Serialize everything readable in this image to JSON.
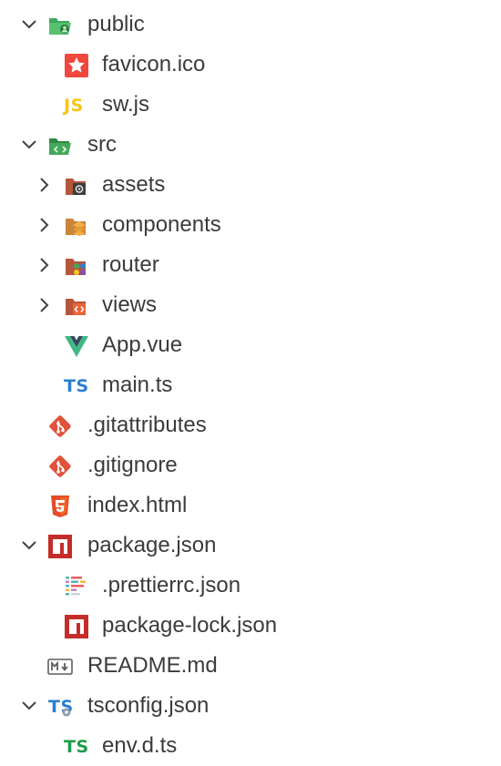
{
  "explorer": {
    "items": [
      {
        "label": "public",
        "icon": "folder-public-open-icon",
        "expanded": true
      },
      {
        "label": "favicon.ico",
        "icon": "favicon-icon"
      },
      {
        "label": "sw.js",
        "icon": "javascript-file-icon",
        "icon_text": "JS",
        "icon_color": "#f5c518"
      },
      {
        "label": "src",
        "icon": "folder-src-open-icon",
        "expanded": true
      },
      {
        "label": "assets",
        "icon": "folder-assets-icon",
        "expanded": false
      },
      {
        "label": "components",
        "icon": "folder-components-icon",
        "expanded": false
      },
      {
        "label": "router",
        "icon": "folder-router-icon",
        "expanded": false
      },
      {
        "label": "views",
        "icon": "folder-views-icon",
        "expanded": false
      },
      {
        "label": "App.vue",
        "icon": "vue-file-icon"
      },
      {
        "label": "main.ts",
        "icon": "typescript-file-icon",
        "icon_text": "TS",
        "icon_color": "#2b7fd0"
      },
      {
        "label": ".gitattributes",
        "icon": "git-icon"
      },
      {
        "label": ".gitignore",
        "icon": "git-icon"
      },
      {
        "label": "index.html",
        "icon": "html5-icon"
      },
      {
        "label": "package.json",
        "icon": "npm-icon",
        "expanded": true
      },
      {
        "label": ".prettierrc.json",
        "icon": "prettier-icon"
      },
      {
        "label": "package-lock.json",
        "icon": "npm-icon"
      },
      {
        "label": "README.md",
        "icon": "markdown-icon"
      },
      {
        "label": "tsconfig.json",
        "icon": "tsconfig-icon",
        "icon_text": "TS",
        "icon_color": "#2b7fd0",
        "expanded": true
      },
      {
        "label": "env.d.ts",
        "icon": "typescript-def-icon",
        "icon_text": "TS",
        "icon_color": "#1e9b4a"
      }
    ]
  },
  "colors": {
    "text": "#3b3b3b",
    "twisty": "#424242",
    "folder_green": "#3fa85a",
    "folder_brown": "#b5563b",
    "git": "#e0533a",
    "html": "#e44d26",
    "npm": "#c42d2a",
    "vue_light": "#41b883",
    "vue_dark": "#35495e"
  }
}
